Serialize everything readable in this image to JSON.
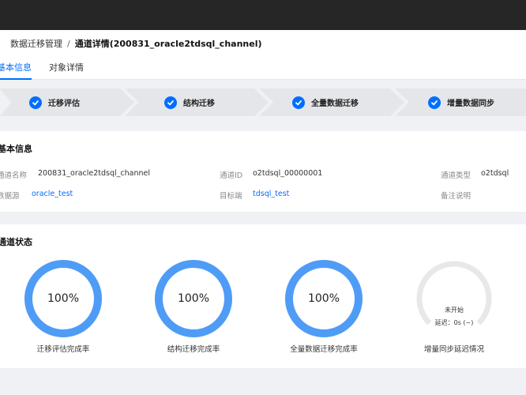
{
  "breadcrumb": {
    "parent": "数据迁移管理",
    "separator": "/",
    "current": "通道详情(200831_oracle2tdsql_channel)"
  },
  "tabs": [
    {
      "label": "基本信息",
      "active": true
    },
    {
      "label": "对象详情",
      "active": false
    }
  ],
  "steps": [
    {
      "label": "迁移评估",
      "done": true
    },
    {
      "label": "结构迁移",
      "done": true
    },
    {
      "label": "全量数据迁移",
      "done": true
    },
    {
      "label": "增量数据同步",
      "done": true
    }
  ],
  "basic_info": {
    "title": "基本信息",
    "channel_name": {
      "label": "通道名称",
      "value": "200831_oracle2tdsql_channel"
    },
    "channel_id": {
      "label": "通道ID",
      "value": "o2tdsql_00000001"
    },
    "channel_type": {
      "label": "通道类型",
      "value": "o2tdsql"
    },
    "source": {
      "label": "数据源",
      "value": "oracle_test"
    },
    "target": {
      "label": "目标端",
      "value": "tdsql_test"
    },
    "remark": {
      "label": "备注说明",
      "value": ""
    }
  },
  "channel_status": {
    "title": "通道状态",
    "gauges": [
      {
        "value_text": "100%",
        "progress": 1.0,
        "label": "迁移评估完成率"
      },
      {
        "value_text": "100%",
        "progress": 1.0,
        "label": "结构迁移完成率"
      },
      {
        "value_text": "100%",
        "progress": 1.0,
        "label": "全量数据迁移完成率"
      }
    ],
    "sync": {
      "status": "未开始",
      "delay": "延迟：0s (~)",
      "label": "增量同步延迟情况"
    }
  },
  "colors": {
    "accent": "#006eff",
    "gauge_fill": "#4f9cf7",
    "gauge_track": "#e8e8e8",
    "step_bg": "#e4e6ea",
    "topbar": "#262626"
  }
}
